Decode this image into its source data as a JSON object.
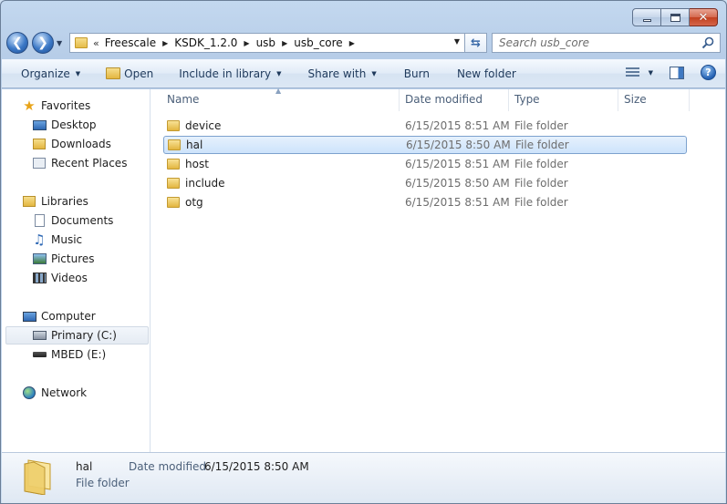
{
  "window": {
    "caption": {
      "minimize": "–",
      "maximize": "□",
      "close": "✕"
    }
  },
  "address": {
    "chevron": "«",
    "breadcrumbs": [
      "Freescale",
      "KSDK_1.2.0",
      "usb",
      "usb_core"
    ]
  },
  "search": {
    "placeholder": "Search usb_core"
  },
  "toolbar": {
    "organize": "Organize",
    "open": "Open",
    "include_in_library": "Include in library",
    "share_with": "Share with",
    "burn": "Burn",
    "new_folder": "New folder",
    "help": "?"
  },
  "nav": {
    "favorites": "Favorites",
    "desktop": "Desktop",
    "downloads": "Downloads",
    "recent_places": "Recent Places",
    "libraries": "Libraries",
    "documents": "Documents",
    "music": "Music",
    "pictures": "Pictures",
    "videos": "Videos",
    "computer": "Computer",
    "primary_c": "Primary (C:)",
    "mbed_e": "MBED (E:)",
    "network": "Network"
  },
  "columns": {
    "name": "Name",
    "date_modified": "Date modified",
    "type": "Type",
    "size": "Size"
  },
  "files": [
    {
      "name": "device",
      "date": "6/15/2015 8:51 AM",
      "type": "File folder"
    },
    {
      "name": "hal",
      "date": "6/15/2015 8:50 AM",
      "type": "File folder",
      "selected": true
    },
    {
      "name": "host",
      "date": "6/15/2015 8:51 AM",
      "type": "File folder"
    },
    {
      "name": "include",
      "date": "6/15/2015 8:50 AM",
      "type": "File folder"
    },
    {
      "name": "otg",
      "date": "6/15/2015 8:51 AM",
      "type": "File folder"
    }
  ],
  "details": {
    "name": "hal",
    "type": "File folder",
    "date_label": "Date modified:",
    "date_value": "6/15/2015 8:50 AM"
  },
  "colors": {
    "accent": "#3b78c6",
    "toolbar_text": "#1e395b",
    "selection": "#cde3fb"
  }
}
